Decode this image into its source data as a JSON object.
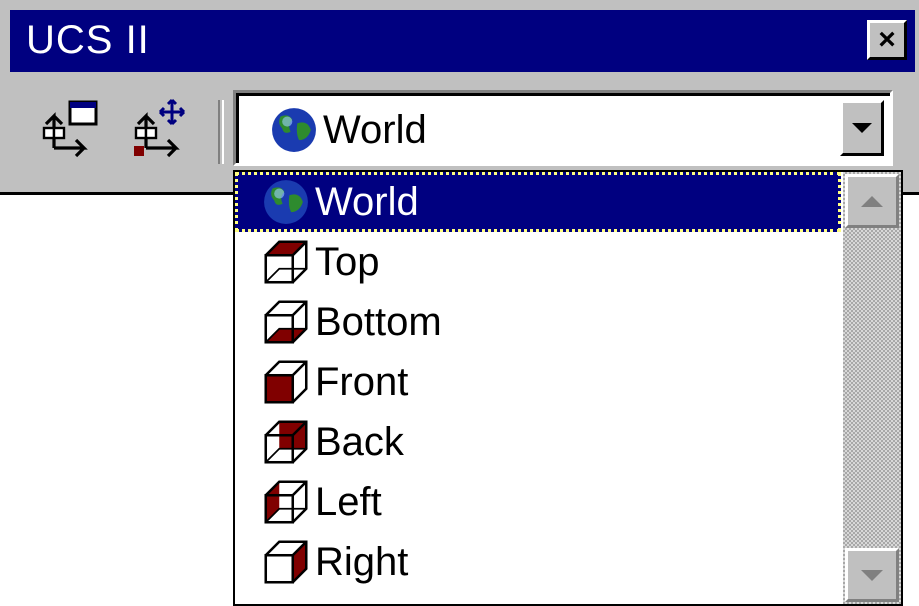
{
  "window": {
    "title": "UCS II",
    "close_symbol": "×"
  },
  "toolbar": {
    "buttons": [
      {
        "icon": "ucs-dialog-icon"
      },
      {
        "icon": "ucs-move-icon"
      }
    ]
  },
  "combo": {
    "selected": "World",
    "selected_icon": "globe-icon"
  },
  "dropdown": {
    "items": [
      {
        "label": "World",
        "icon": "globe-icon",
        "selected": true
      },
      {
        "label": "Top",
        "icon": "cube-top-icon"
      },
      {
        "label": "Bottom",
        "icon": "cube-bottom-icon"
      },
      {
        "label": "Front",
        "icon": "cube-front-icon"
      },
      {
        "label": "Back",
        "icon": "cube-back-icon"
      },
      {
        "label": "Left",
        "icon": "cube-left-icon"
      },
      {
        "label": "Right",
        "icon": "cube-right-icon"
      }
    ]
  },
  "colors": {
    "title_bar": "#000080",
    "face": "#c0c0c0",
    "highlight": "#000080",
    "cube_face": "#800000"
  }
}
